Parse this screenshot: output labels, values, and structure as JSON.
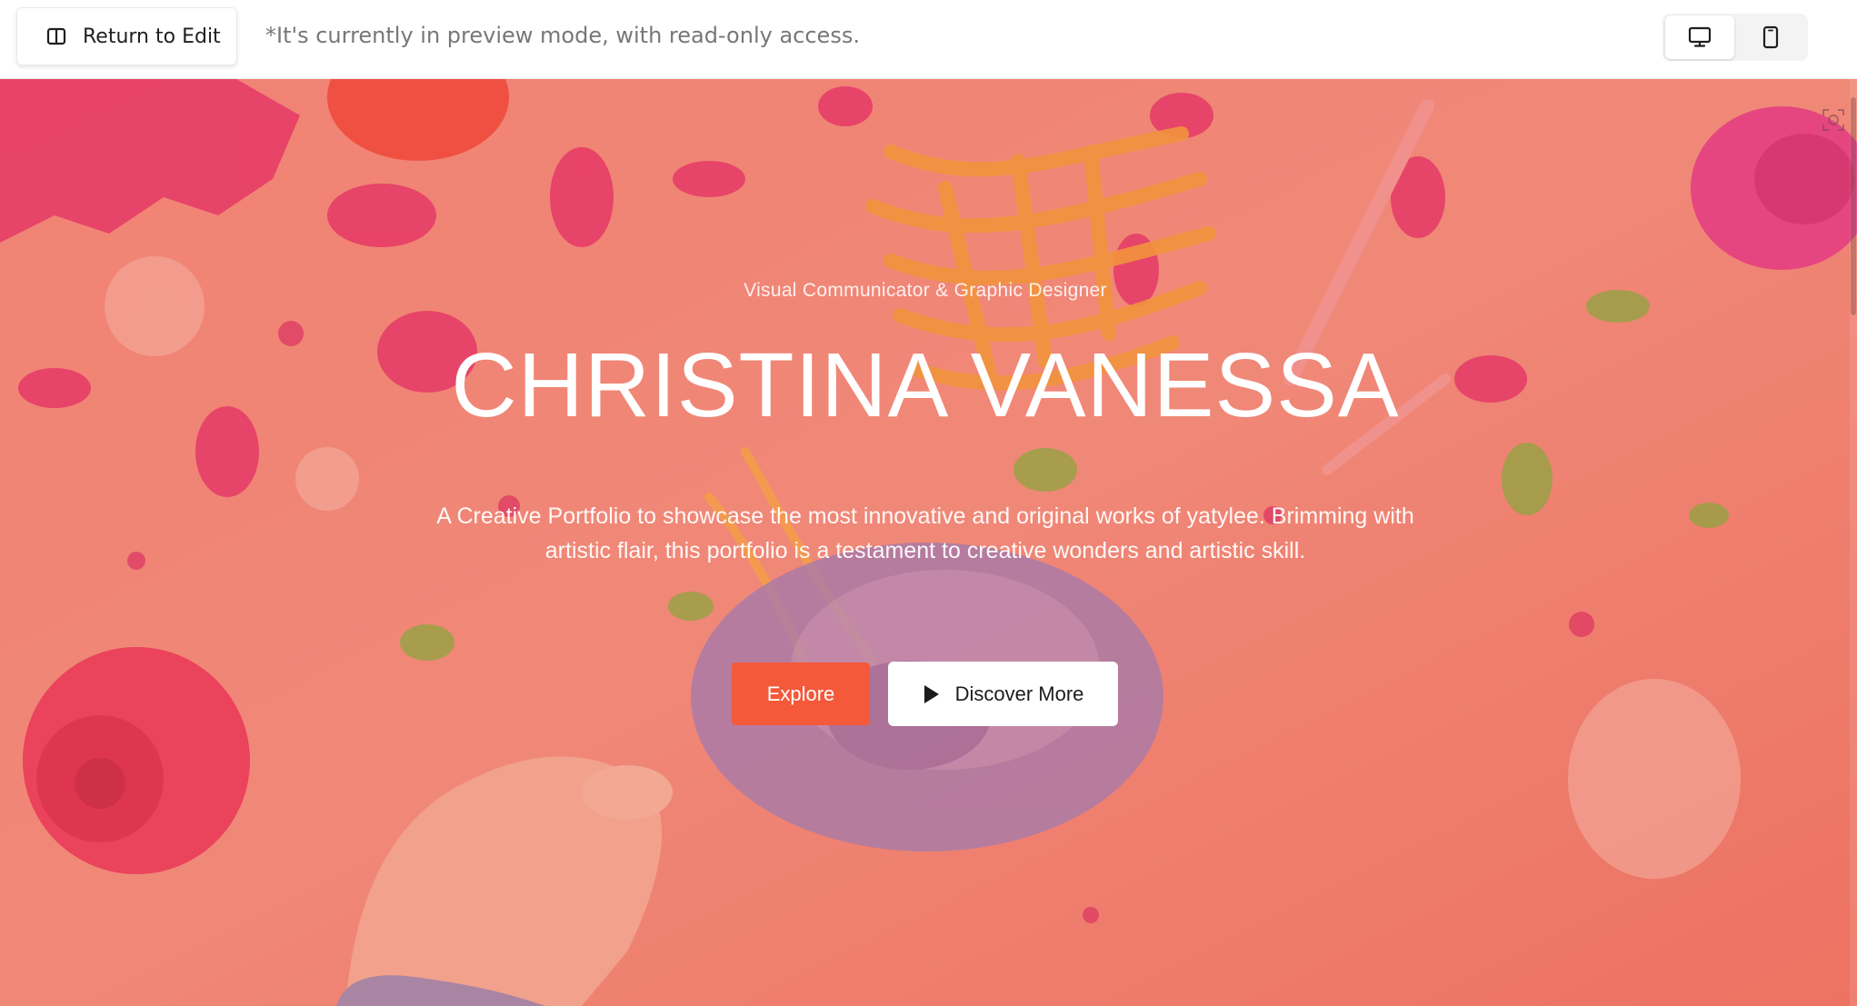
{
  "topbar": {
    "return_label": "Return to Edit",
    "preview_note": "*It's currently in preview mode, with read-only access.",
    "device_options": [
      "desktop-view",
      "mobile-view"
    ],
    "active_device": "desktop-view"
  },
  "hero": {
    "subtitle": "Visual Communicator & Graphic Designer",
    "title": "CHRISTINA VANESSA",
    "description": "A Creative Portfolio to showcase the most innovative and original works of yatylee. Brimming with artistic flair, this portfolio is a testament to creative wonders and artistic skill.",
    "primary_button": "Explore",
    "secondary_button": "Discover More",
    "background_image": "children's paint splatter artwork with paint bottles and a child's hand",
    "overlay_color": "#ee7060"
  },
  "colors": {
    "accent": "#f4593a",
    "topbar_bg": "#ffffff",
    "note_text": "#777777"
  },
  "icons": [
    "panel-icon",
    "desktop-icon",
    "mobile-icon",
    "play-icon",
    "scan-icon"
  ]
}
